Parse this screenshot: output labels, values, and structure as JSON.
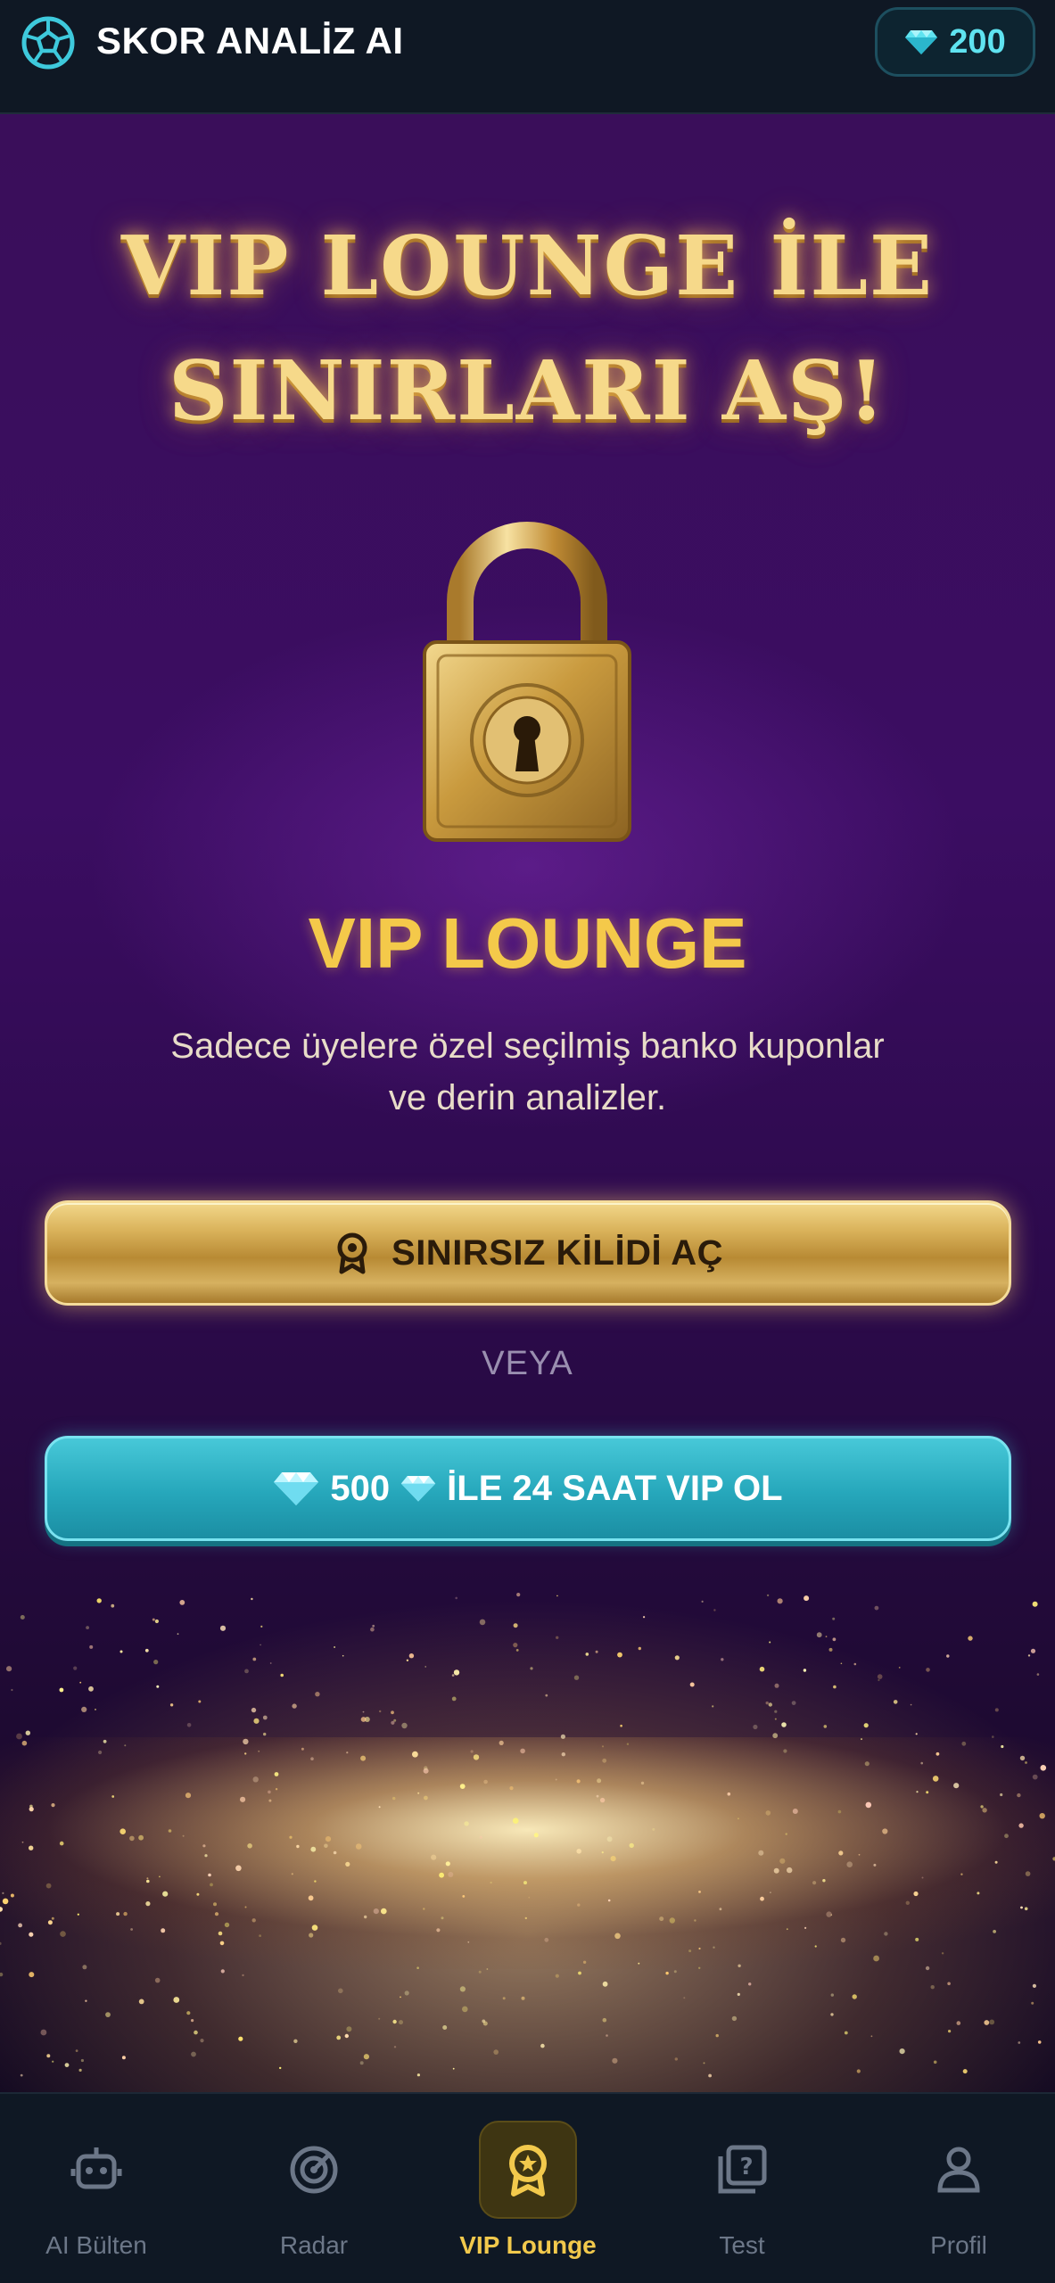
{
  "app": {
    "title": "SKOR ANALİZ AI",
    "gem_balance": "200",
    "brand_icon": "soccer-ball-icon"
  },
  "colors": {
    "accent_gold": "#f4c94a",
    "accent_teal": "#2ab3c6",
    "background": "#3b0d62"
  },
  "hero": {
    "headline_line1": "VIP LOUNGE İLE",
    "headline_line2": "SINIRLARI AŞ!",
    "title": "VIP LOUNGE",
    "description": "Sadece üyelere özel seçilmiş banko kuponlar ve derin analizler."
  },
  "actions": {
    "unlock_label": "SINIRSIZ KİLİDİ AÇ",
    "or_label": "VEYA",
    "gem_amount": "500",
    "vip_suffix": "İLE 24 SAAT VIP OL"
  },
  "nav": {
    "items": [
      {
        "label": "AI Bülten",
        "icon": "robot-icon"
      },
      {
        "label": "Radar",
        "icon": "radar-icon"
      },
      {
        "label": "VIP Lounge",
        "icon": "award-icon",
        "active": true
      },
      {
        "label": "Test",
        "icon": "quiz-icon"
      },
      {
        "label": "Profil",
        "icon": "profile-icon"
      }
    ]
  }
}
